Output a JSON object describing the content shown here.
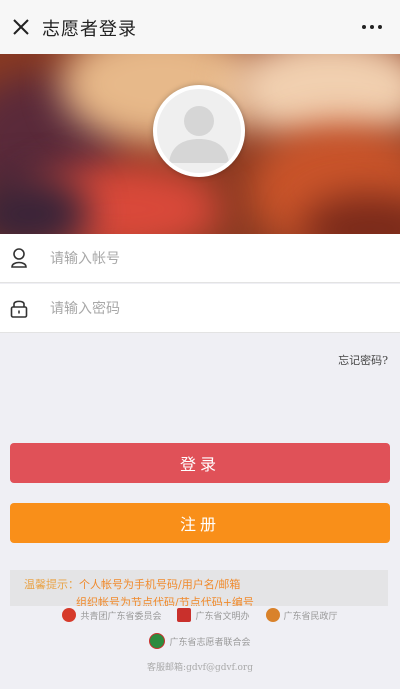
{
  "header": {
    "title": "志愿者登录",
    "close_icon": "close-icon",
    "more_icon": "more-icon"
  },
  "banner": {
    "avatar_icon": "default-avatar-icon"
  },
  "form": {
    "account_placeholder": "请输入帐号",
    "password_placeholder": "请输入密码",
    "account_icon": "user-icon",
    "password_icon": "lock-icon",
    "forgot_label": "忘记密码?"
  },
  "buttons": {
    "login_label": "登录",
    "register_label": "注册"
  },
  "tips": {
    "label": "温馨提示：",
    "line1": "个人帐号为手机号码/用户名/邮箱",
    "line2": "组织帐号为节点代码/节点代码+编号"
  },
  "footer": {
    "orgs": [
      {
        "name": "共青团广东省委员会",
        "logo_color": "#d63a2a"
      },
      {
        "name": "广东省文明办",
        "logo_color": "#c9302c"
      },
      {
        "name": "广东省民政厅",
        "logo_color": "#d9822b"
      }
    ],
    "federation": {
      "name": "广东省志愿者联合会",
      "logo_color": "#2e8b3e"
    },
    "contact": "客服邮箱:gdvf@gdvf.org"
  },
  "colors": {
    "login_button": "#e05158",
    "register_button": "#f98f19",
    "tips_text": "#f08a2c"
  }
}
